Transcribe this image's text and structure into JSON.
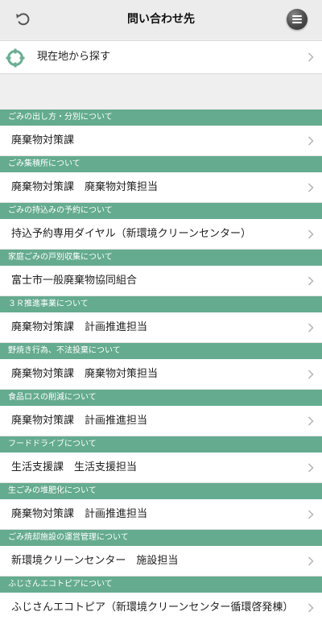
{
  "header": {
    "title": "問い合わせ先"
  },
  "location": {
    "label": "現在地から探す"
  },
  "sections": [
    {
      "heading": "ごみの出し方・分別について",
      "item": "廃棄物対策課"
    },
    {
      "heading": "ごみ集積所について",
      "item": "廃棄物対策課　廃棄物対策担当"
    },
    {
      "heading": "ごみの持込みの予約について",
      "item": "持込予約専用ダイヤル（新環境クリーンセンター）"
    },
    {
      "heading": "家庭ごみの戸別収集について",
      "item": "富士市一般廃棄物協同組合"
    },
    {
      "heading": "３Ｒ推進事業について",
      "item": "廃棄物対策課　計画推進担当"
    },
    {
      "heading": "野焼き行為、不法投棄について",
      "item": "廃棄物対策課　廃棄物対策担当"
    },
    {
      "heading": "食品ロスの削減について",
      "item": "廃棄物対策課　計画推進担当"
    },
    {
      "heading": "フードドライブについて",
      "item": "生活支援課　生活支援担当"
    },
    {
      "heading": "生ごみの堆肥化について",
      "item": "廃棄物対策課　計画推進担当"
    },
    {
      "heading": "ごみ焼却施設の運営管理について",
      "item": "新環境クリーンセンター　施設担当"
    },
    {
      "heading": "ふじさんエコトピアについて",
      "item": "ふじさんエコトピア（新環境クリーンセンター循環啓発棟）"
    }
  ],
  "icons": {
    "back": "undo-arrow-icon",
    "menu": "menu-icon",
    "location": "crosshair-icon",
    "chevron": "chevron-right-icon"
  },
  "colors": {
    "section_header": "#65ab8f",
    "location_icon": "#6aae92"
  }
}
